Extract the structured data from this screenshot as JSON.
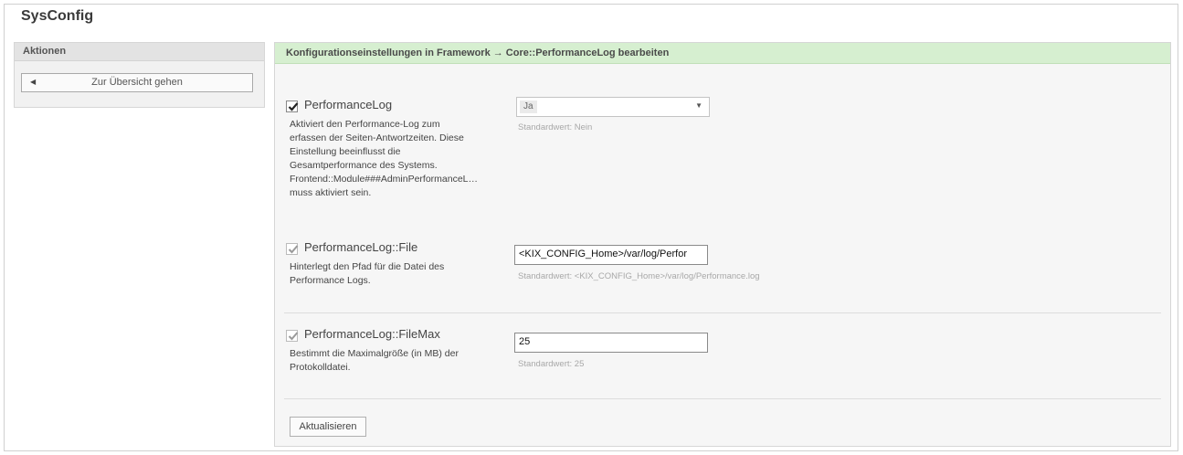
{
  "page": {
    "title": "SysConfig"
  },
  "sidebar": {
    "heading": "Aktionen",
    "overview_button": "Zur Übersicht gehen"
  },
  "main": {
    "heading": "Konfigurationseinstellungen in Framework → Core::PerformanceLog bearbeiten",
    "settings": [
      {
        "title": "PerformanceLog",
        "checked": true,
        "enabled": true,
        "description": [
          "Aktiviert den Performance-Log zum",
          "erfassen der Seiten-Antwortzeiten. Diese",
          "Einstellung beeinflusst die",
          "Gesamtperformance des Systems.",
          "Frontend::Module###AdminPerformanceL…",
          "muss aktiviert sein."
        ],
        "control": "select",
        "value": "Ja",
        "default": "Standardwert: Nein"
      },
      {
        "title": "PerformanceLog::File",
        "checked": true,
        "enabled": false,
        "description": [
          "Hinterlegt den Pfad für die Datei des",
          "Performance Logs."
        ],
        "control": "input",
        "value": "<KIX_CONFIG_Home>/var/log/Perfor",
        "default": "Standardwert: <KIX_CONFIG_Home>/var/log/Performance.log"
      },
      {
        "title": "PerformanceLog::FileMax",
        "checked": true,
        "enabled": false,
        "description": [
          "Bestimmt die Maximalgröße (in MB) der",
          "Protokolldatei."
        ],
        "control": "input",
        "value": "25",
        "default": "Standardwert: 25"
      }
    ],
    "update_button": "Aktualisieren"
  }
}
